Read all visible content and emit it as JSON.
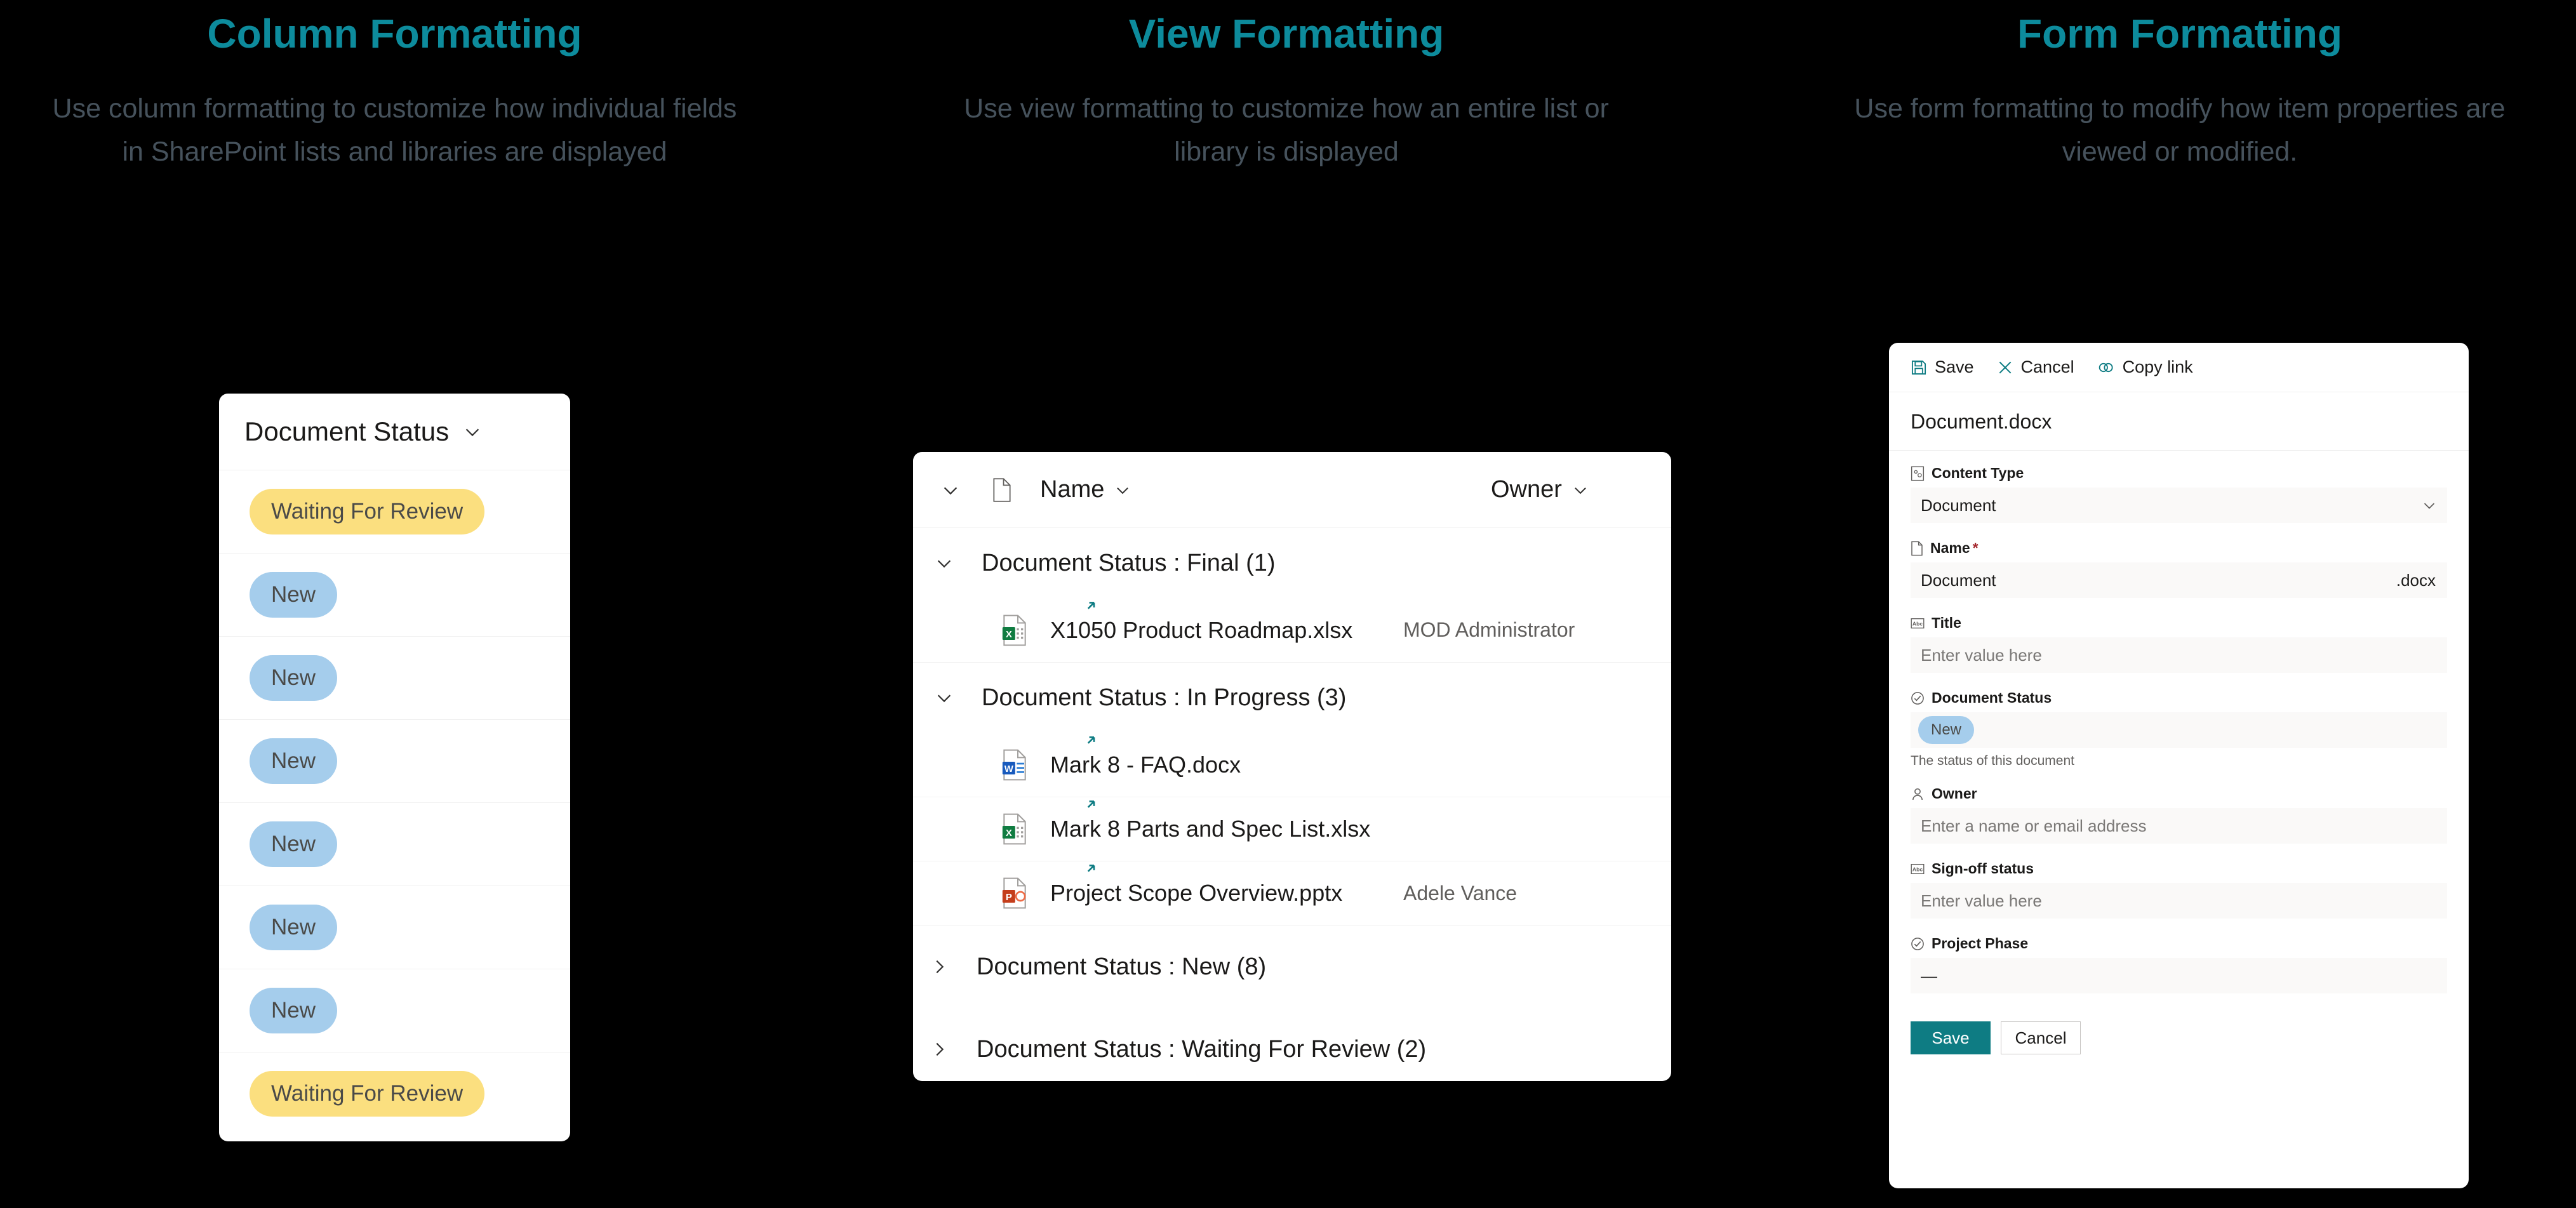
{
  "sections": [
    {
      "title": "Column Formatting",
      "description": "Use column formatting to customize how individual fields in SharePoint lists and libraries are displayed"
    },
    {
      "title": "View Formatting",
      "description": "Use view formatting to customize how an entire list or library is displayed"
    },
    {
      "title": "Form Formatting",
      "description": "Use form formatting to modify how item properties are viewed or modified."
    }
  ],
  "theme": {
    "heading_color": "#0d8b9c",
    "description_color": "#46525c",
    "page_background": "#000000",
    "card_background": "#ffffff",
    "pill_blue": "#a5cdec",
    "pill_yellow": "#fbdf7f",
    "primary_button": "#0e7c83"
  },
  "column_card": {
    "header_label": "Document Status",
    "rows": [
      {
        "value": "Waiting For Review",
        "style": "yellow"
      },
      {
        "value": "New",
        "style": "blue"
      },
      {
        "value": "New",
        "style": "blue"
      },
      {
        "value": "New",
        "style": "blue"
      },
      {
        "value": "New",
        "style": "blue"
      },
      {
        "value": "New",
        "style": "blue"
      },
      {
        "value": "New",
        "style": "blue"
      },
      {
        "value": "Waiting For Review",
        "style": "yellow"
      }
    ]
  },
  "view_card": {
    "columns": {
      "name": "Name",
      "owner": "Owner"
    },
    "groups": [
      {
        "label": "Document Status : Final (1)",
        "expanded": true,
        "items": [
          {
            "name": "X1050 Product Roadmap.xlsx",
            "filetype": "xlsx",
            "owner": "MOD Administrator"
          }
        ]
      },
      {
        "label": "Document Status : In Progress (3)",
        "expanded": true,
        "items": [
          {
            "name": "Mark 8 - FAQ.docx",
            "filetype": "docx",
            "owner": ""
          },
          {
            "name": "Mark 8 Parts and Spec List.xlsx",
            "filetype": "xlsx",
            "owner": ""
          },
          {
            "name": "Project Scope Overview.pptx",
            "filetype": "pptx",
            "owner": "Adele Vance"
          }
        ]
      },
      {
        "label": "Document Status : New (8)",
        "expanded": false,
        "items": []
      },
      {
        "label": "Document Status : Waiting For Review (2)",
        "expanded": false,
        "items": []
      }
    ]
  },
  "form_card": {
    "commands": [
      {
        "icon": "save-icon",
        "label": "Save"
      },
      {
        "icon": "cancel-icon",
        "label": "Cancel"
      },
      {
        "icon": "copy-link-icon",
        "label": "Copy link"
      }
    ],
    "file_title": "Document.docx",
    "fields": [
      {
        "icon": "content-type-icon",
        "label": "Content Type",
        "required": false,
        "value": "Document",
        "placeholder": "",
        "control": "dropdown",
        "suffix": "",
        "help": ""
      },
      {
        "icon": "file-icon",
        "label": "Name",
        "required": true,
        "value": "Document",
        "placeholder": "",
        "control": "text",
        "suffix": ".docx",
        "help": ""
      },
      {
        "icon": "text-icon",
        "label": "Title",
        "required": false,
        "value": "",
        "placeholder": "Enter value here",
        "control": "text",
        "suffix": "",
        "help": ""
      },
      {
        "icon": "choice-icon",
        "label": "Document Status",
        "required": false,
        "value": "New",
        "placeholder": "",
        "control": "pill",
        "suffix": "",
        "help": "The status of this document"
      },
      {
        "icon": "person-icon",
        "label": "Owner",
        "required": false,
        "value": "",
        "placeholder": "Enter a name or email address",
        "control": "text",
        "suffix": "",
        "help": ""
      },
      {
        "icon": "text-icon",
        "label": "Sign-off status",
        "required": false,
        "value": "",
        "placeholder": "Enter value here",
        "control": "text",
        "suffix": "",
        "help": ""
      },
      {
        "icon": "choice-icon",
        "label": "Project Phase",
        "required": false,
        "value": "—",
        "placeholder": "",
        "control": "text",
        "suffix": "",
        "help": ""
      }
    ],
    "actions": {
      "save": "Save",
      "cancel": "Cancel"
    }
  }
}
